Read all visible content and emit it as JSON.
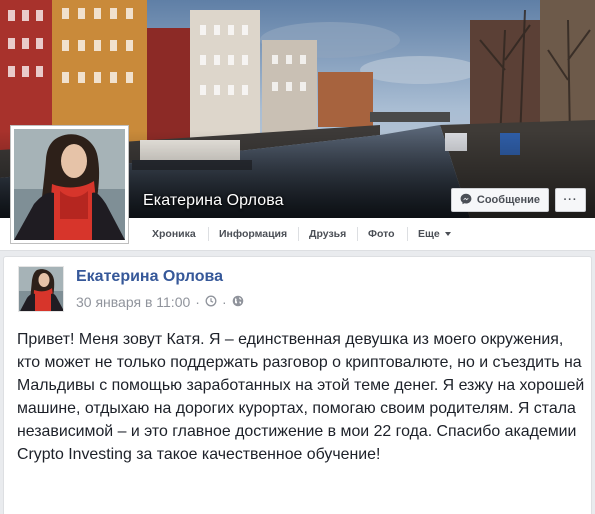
{
  "profile": {
    "name": "Екатерина Орлова"
  },
  "cover_actions": {
    "message_label": "Сообщение",
    "more_label": "···"
  },
  "tabs": [
    {
      "label": "Хроника",
      "active": true
    },
    {
      "label": "Информация"
    },
    {
      "label": "Друзья"
    },
    {
      "label": "Фото"
    },
    {
      "label": "Еще"
    }
  ],
  "post": {
    "author": "Екатерина Орлова",
    "date": "30 января в 11:00",
    "text": "Привет! Меня зовут Катя. Я – единственная девушка из моего окружения, кто может не только поддержать разговор о криптовалюте, но и съездить на Мальдивы с помощью заработанных на этой теме денег. Я езжу на хорошей машине, отдыхаю на дорогих курортах, помогаю своим родителям. Я стала независимой – и это главное достижение в мои 22 года. Спасибо академии Crypto Investing за такое качественное обучение!"
  },
  "icons": {
    "message": "messenger-icon",
    "time": "clock-icon",
    "privacy": "globe-icon",
    "dropdown": "caret-down-icon"
  },
  "colors": {
    "link": "#365899",
    "meta": "#90949c",
    "text": "#1d2129",
    "page_bg": "#e9ebee"
  }
}
